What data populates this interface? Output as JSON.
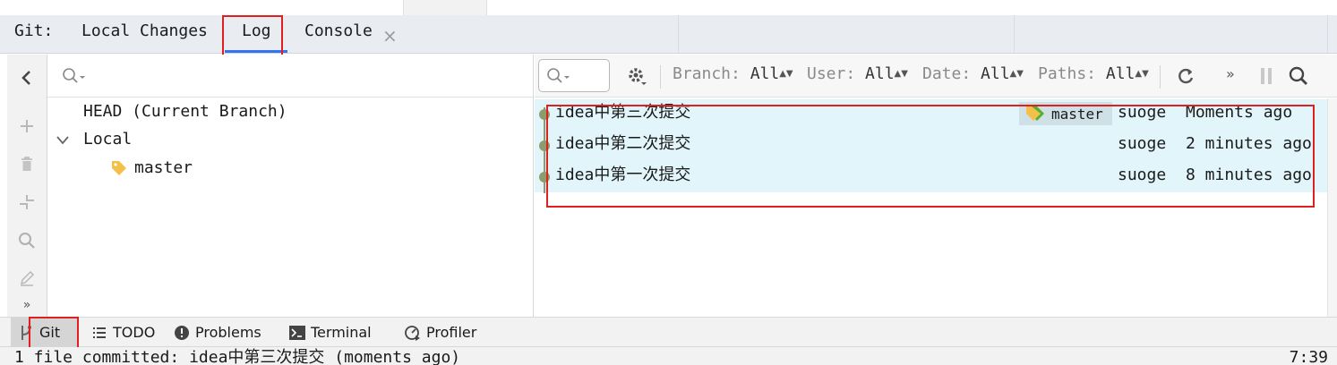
{
  "tool_window": {
    "title": "Git:",
    "tabs": [
      {
        "label": "Local Changes",
        "active": false
      },
      {
        "label": "Log",
        "active": true
      },
      {
        "label": "Console",
        "active": false
      }
    ]
  },
  "branches": {
    "head_label": "HEAD (Current Branch)",
    "local_label": "Local",
    "branch_name": "master"
  },
  "log_filters": [
    {
      "key": "Branch:",
      "value": "All"
    },
    {
      "key": "User:",
      "value": "All"
    },
    {
      "key": "Date:",
      "value": "All"
    },
    {
      "key": "Paths:",
      "value": "All"
    }
  ],
  "commits": [
    {
      "message": "idea中第三次提交",
      "ref": "master",
      "author": "suoge",
      "date": "Moments ago"
    },
    {
      "message": "idea中第二次提交",
      "ref": "",
      "author": "suoge",
      "date": "2 minutes ago"
    },
    {
      "message": "idea中第一次提交",
      "ref": "",
      "author": "suoge",
      "date": "8 minutes ago"
    }
  ],
  "bottom_tools": [
    {
      "label": "Git",
      "icon": "git-branch-icon",
      "active": true
    },
    {
      "label": "TODO",
      "icon": "list-icon",
      "active": false
    },
    {
      "label": "Problems",
      "icon": "problems-icon",
      "active": false
    },
    {
      "label": "Terminal",
      "icon": "terminal-icon",
      "active": false
    },
    {
      "label": "Profiler",
      "icon": "profiler-icon",
      "active": false
    }
  ],
  "status": {
    "message": "1 file committed: idea中第三次提交 (moments ago)",
    "time": "7:39"
  },
  "colors": {
    "accent": "#3574f0",
    "row_highlight": "#e1f5fb",
    "graph": "#8c9c6c",
    "annotation": "#e02020",
    "tag": "#f5c04a",
    "ref_tag": "#55b030"
  }
}
